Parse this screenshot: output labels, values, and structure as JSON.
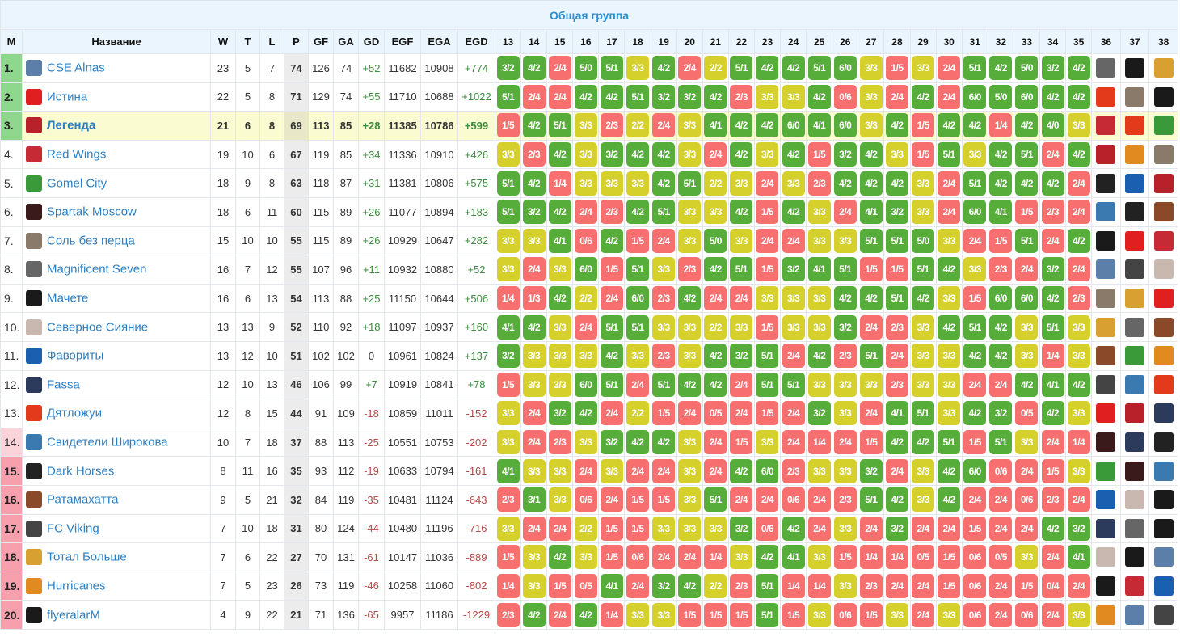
{
  "title": "Общая группа",
  "headers": {
    "m": "M",
    "name": "Название",
    "w": "W",
    "t": "T",
    "l": "L",
    "p": "P",
    "gf": "GF",
    "ga": "GA",
    "gd": "GD",
    "egf": "EGF",
    "ega": "EGA",
    "egd": "EGD"
  },
  "round_headers": [
    "13",
    "14",
    "15",
    "16",
    "17",
    "18",
    "19",
    "20",
    "21",
    "22",
    "23",
    "24",
    "25",
    "26",
    "27",
    "28",
    "29",
    "30",
    "31",
    "32",
    "33",
    "34",
    "35",
    "36",
    "37",
    "38"
  ],
  "colors": {
    "win": "#56ad3a",
    "draw": "#d6d02c",
    "loss": "#f76f6f",
    "accent": "#2a8fcf"
  },
  "logos": {
    "cse-alnas": "#5b7fa8",
    "istina": "#e02020",
    "legenda": "#b8202a",
    "red-wings": "#c52a35",
    "gomel-city": "#3a9a3a",
    "spartak-moscow": "#3a1a1a",
    "sol-bez-perca": "#8a7a6a",
    "magnificent-seven": "#666666",
    "machete": "#1a1a1a",
    "severnoe-siyanie": "#c8b8b0",
    "favority": "#1a5fb0",
    "fassa": "#2c3a5c",
    "dyatlozhui": "#e23a1a",
    "svideteli": "#3a7ab0",
    "dark-horses": "#222222",
    "ratamahatta": "#8a4a2a",
    "fc-viking": "#444444",
    "total-bolshe": "#d8a030",
    "hurricanes": "#e08a20",
    "flyeralarm": "#1a1a1a"
  },
  "rows": [
    {
      "pos": "1.",
      "zone": "top",
      "name": "CSE Alnas",
      "logo": "cse-alnas",
      "w": "23",
      "t": "5",
      "l": "7",
      "p": "74",
      "gf": "126",
      "ga": "74",
      "gd": "+52",
      "egf": "11682",
      "ega": "10908",
      "egd": "+774",
      "results": [
        "3/2",
        "4/2",
        "2/4",
        "5/0",
        "5/1",
        "3/3",
        "4/2",
        "2/4",
        "2/2",
        "5/1",
        "4/2",
        "4/2",
        "5/1",
        "6/0",
        "3/3",
        "1/5",
        "3/3",
        "2/4",
        "5/1",
        "4/2",
        "5/0",
        "3/2",
        "4/2"
      ],
      "next": [
        "magnificent-seven",
        "flyeralarm",
        "total-bolshe"
      ]
    },
    {
      "pos": "2.",
      "zone": "top",
      "name": "Истина",
      "logo": "istina",
      "w": "22",
      "t": "5",
      "l": "8",
      "p": "71",
      "gf": "129",
      "ga": "74",
      "gd": "+55",
      "egf": "11710",
      "ega": "10688",
      "egd": "+1022",
      "results": [
        "5/1",
        "2/4",
        "2/4",
        "4/2",
        "4/2",
        "5/1",
        "3/2",
        "3/2",
        "4/2",
        "2/3",
        "3/3",
        "3/3",
        "4/2",
        "0/6",
        "3/3",
        "2/4",
        "4/2",
        "2/4",
        "6/0",
        "5/0",
        "6/0",
        "4/2",
        "4/2"
      ],
      "next": [
        "dyatlozhui",
        "sol-bez-perca",
        "machete"
      ]
    },
    {
      "pos": "3.",
      "zone": "top",
      "highlight": true,
      "name": "Легенда",
      "logo": "legenda",
      "w": "21",
      "t": "6",
      "l": "8",
      "p": "69",
      "gf": "113",
      "ga": "85",
      "gd": "+28",
      "egf": "11385",
      "ega": "10786",
      "egd": "+599",
      "results": [
        "1/5",
        "4/2",
        "5/1",
        "3/3",
        "2/3",
        "2/2",
        "2/4",
        "3/3",
        "4/1",
        "4/2",
        "4/2",
        "6/0",
        "4/1",
        "6/0",
        "3/3",
        "4/2",
        "1/5",
        "4/2",
        "4/2",
        "1/4",
        "4/2",
        "4/0",
        "3/3"
      ],
      "next": [
        "red-wings",
        "dyatlozhui",
        "gomel-city"
      ]
    },
    {
      "pos": "4.",
      "zone": "mid",
      "name": "Red Wings",
      "logo": "red-wings",
      "w": "19",
      "t": "10",
      "l": "6",
      "p": "67",
      "gf": "119",
      "ga": "85",
      "gd": "+34",
      "egf": "11336",
      "ega": "10910",
      "egd": "+426",
      "results": [
        "3/3",
        "2/3",
        "4/2",
        "3/3",
        "3/2",
        "4/2",
        "4/2",
        "3/3",
        "2/4",
        "4/2",
        "3/3",
        "4/2",
        "1/5",
        "3/2",
        "4/2",
        "3/3",
        "1/5",
        "5/1",
        "3/3",
        "4/2",
        "5/1",
        "2/4",
        "4/2"
      ],
      "next": [
        "legenda",
        "hurricanes",
        "sol-bez-perca"
      ]
    },
    {
      "pos": "5.",
      "zone": "mid",
      "name": "Gomel City",
      "logo": "gomel-city",
      "w": "18",
      "t": "9",
      "l": "8",
      "p": "63",
      "gf": "118",
      "ga": "87",
      "gd": "+31",
      "egf": "11381",
      "ega": "10806",
      "egd": "+575",
      "results": [
        "5/1",
        "4/2",
        "1/4",
        "3/3",
        "3/3",
        "3/3",
        "4/2",
        "5/1",
        "2/2",
        "3/3",
        "2/4",
        "3/3",
        "2/3",
        "4/2",
        "4/2",
        "4/2",
        "3/3",
        "2/4",
        "5/1",
        "4/2",
        "4/2",
        "4/2",
        "2/4"
      ],
      "next": [
        "dark-horses",
        "favority",
        "legenda"
      ]
    },
    {
      "pos": "6.",
      "zone": "mid",
      "name": "Spartak Moscow",
      "logo": "spartak-moscow",
      "w": "18",
      "t": "6",
      "l": "11",
      "p": "60",
      "gf": "115",
      "ga": "89",
      "gd": "+26",
      "egf": "11077",
      "ega": "10894",
      "egd": "+183",
      "results": [
        "5/1",
        "3/2",
        "4/2",
        "2/4",
        "2/3",
        "4/2",
        "5/1",
        "3/3",
        "3/3",
        "4/2",
        "1/5",
        "4/2",
        "3/3",
        "2/4",
        "4/1",
        "3/2",
        "3/3",
        "2/4",
        "6/0",
        "4/1",
        "1/5",
        "2/3",
        "2/4"
      ],
      "next": [
        "svideteli",
        "dark-horses",
        "ratamahatta"
      ]
    },
    {
      "pos": "7.",
      "zone": "mid",
      "name": "Соль без перца",
      "logo": "sol-bez-perca",
      "w": "15",
      "t": "10",
      "l": "10",
      "p": "55",
      "gf": "115",
      "ga": "89",
      "gd": "+26",
      "egf": "10929",
      "ega": "10647",
      "egd": "+282",
      "results": [
        "3/3",
        "3/3",
        "4/1",
        "0/6",
        "4/2",
        "1/5",
        "2/4",
        "3/3",
        "5/0",
        "3/3",
        "2/4",
        "2/4",
        "3/3",
        "3/3",
        "5/1",
        "5/1",
        "5/0",
        "3/3",
        "2/4",
        "1/5",
        "5/1",
        "2/4",
        "4/2"
      ],
      "next": [
        "machete",
        "istina",
        "red-wings"
      ]
    },
    {
      "pos": "8.",
      "zone": "mid",
      "name": "Magnificent Seven",
      "logo": "magnificent-seven",
      "w": "16",
      "t": "7",
      "l": "12",
      "p": "55",
      "gf": "107",
      "ga": "96",
      "gd": "+11",
      "egf": "10932",
      "ega": "10880",
      "egd": "+52",
      "results": [
        "3/3",
        "2/4",
        "3/3",
        "6/0",
        "1/5",
        "5/1",
        "3/3",
        "2/3",
        "4/2",
        "5/1",
        "1/5",
        "3/2",
        "4/1",
        "5/1",
        "1/5",
        "1/5",
        "5/1",
        "4/2",
        "3/3",
        "2/3",
        "2/4",
        "3/2",
        "2/4"
      ],
      "next": [
        "cse-alnas",
        "fc-viking",
        "severnoe-siyanie"
      ]
    },
    {
      "pos": "9.",
      "zone": "mid",
      "name": "Мачете",
      "logo": "machete",
      "w": "16",
      "t": "6",
      "l": "13",
      "p": "54",
      "gf": "113",
      "ga": "88",
      "gd": "+25",
      "egf": "11150",
      "ega": "10644",
      "egd": "+506",
      "results": [
        "1/4",
        "1/3",
        "4/2",
        "2/2",
        "2/4",
        "6/0",
        "2/3",
        "4/2",
        "2/4",
        "2/4",
        "3/3",
        "3/3",
        "3/3",
        "4/2",
        "4/2",
        "5/1",
        "4/2",
        "3/3",
        "1/5",
        "6/0",
        "6/0",
        "4/2",
        "2/3"
      ],
      "next": [
        "sol-bez-perca",
        "total-bolshe",
        "istina"
      ]
    },
    {
      "pos": "10.",
      "zone": "mid",
      "name": "Северное Сияние",
      "logo": "severnoe-siyanie",
      "w": "13",
      "t": "13",
      "l": "9",
      "p": "52",
      "gf": "110",
      "ga": "92",
      "gd": "+18",
      "egf": "11097",
      "ega": "10937",
      "egd": "+160",
      "results": [
        "4/1",
        "4/2",
        "3/3",
        "2/4",
        "5/1",
        "5/1",
        "3/3",
        "3/3",
        "2/2",
        "3/3",
        "1/5",
        "3/3",
        "3/3",
        "3/2",
        "2/4",
        "2/3",
        "3/3",
        "4/2",
        "5/1",
        "4/2",
        "3/3",
        "5/1",
        "3/3"
      ],
      "next": [
        "total-bolshe",
        "magnificent-seven",
        "ratamahatta"
      ]
    },
    {
      "pos": "11.",
      "zone": "mid",
      "name": "Фавориты",
      "logo": "favority",
      "w": "13",
      "t": "12",
      "l": "10",
      "p": "51",
      "gf": "102",
      "ga": "102",
      "gd": "0",
      "egf": "10961",
      "ega": "10824",
      "egd": "+137",
      "results": [
        "3/2",
        "3/3",
        "3/3",
        "3/3",
        "4/2",
        "3/3",
        "2/3",
        "3/3",
        "4/2",
        "3/2",
        "5/1",
        "2/4",
        "4/2",
        "2/3",
        "5/1",
        "2/4",
        "3/3",
        "3/3",
        "4/2",
        "4/2",
        "3/3",
        "1/4",
        "3/3"
      ],
      "next": [
        "ratamahatta",
        "gomel-city",
        "hurricanes"
      ]
    },
    {
      "pos": "12.",
      "zone": "mid",
      "name": "Fassa",
      "logo": "fassa",
      "w": "12",
      "t": "10",
      "l": "13",
      "p": "46",
      "gf": "106",
      "ga": "99",
      "gd": "+7",
      "egf": "10919",
      "ega": "10841",
      "egd": "+78",
      "results": [
        "1/5",
        "3/3",
        "3/3",
        "6/0",
        "5/1",
        "2/4",
        "5/1",
        "4/2",
        "4/2",
        "2/4",
        "5/1",
        "5/1",
        "3/3",
        "3/3",
        "3/3",
        "2/3",
        "3/3",
        "3/3",
        "2/4",
        "2/4",
        "4/2",
        "4/1",
        "4/2"
      ],
      "next": [
        "fc-viking",
        "svideteli",
        "dyatlozhui"
      ]
    },
    {
      "pos": "13.",
      "zone": "mid",
      "name": "Дятложуи",
      "logo": "dyatlozhui",
      "w": "12",
      "t": "8",
      "l": "15",
      "p": "44",
      "gf": "91",
      "ga": "109",
      "gd": "-18",
      "egf": "10859",
      "ega": "11011",
      "egd": "-152",
      "results": [
        "3/3",
        "2/4",
        "3/2",
        "4/2",
        "2/4",
        "2/2",
        "1/5",
        "2/4",
        "0/5",
        "2/4",
        "1/5",
        "2/4",
        "3/2",
        "3/3",
        "2/4",
        "4/1",
        "5/1",
        "3/3",
        "4/2",
        "3/2",
        "0/5",
        "4/2",
        "3/3"
      ],
      "next": [
        "istina",
        "legenda",
        "fassa"
      ]
    },
    {
      "pos": "14.",
      "zone": "warn",
      "name": "Свидетели Широкова",
      "logo": "svideteli",
      "w": "10",
      "t": "7",
      "l": "18",
      "p": "37",
      "gf": "88",
      "ga": "113",
      "gd": "-25",
      "egf": "10551",
      "ega": "10753",
      "egd": "-202",
      "results": [
        "3/3",
        "2/4",
        "2/3",
        "3/3",
        "3/2",
        "4/2",
        "4/2",
        "3/3",
        "2/4",
        "1/5",
        "3/3",
        "2/4",
        "1/4",
        "2/4",
        "1/5",
        "4/2",
        "4/2",
        "5/1",
        "1/5",
        "5/1",
        "3/3",
        "2/4",
        "1/4"
      ],
      "next": [
        "spartak-moscow",
        "fassa",
        "dark-horses"
      ]
    },
    {
      "pos": "15.",
      "zone": "rel",
      "name": "Dark Horses",
      "logo": "dark-horses",
      "w": "8",
      "t": "11",
      "l": "16",
      "p": "35",
      "gf": "93",
      "ga": "112",
      "gd": "-19",
      "egf": "10633",
      "ega": "10794",
      "egd": "-161",
      "results": [
        "4/1",
        "3/3",
        "3/3",
        "2/4",
        "3/3",
        "2/4",
        "2/4",
        "3/3",
        "2/4",
        "4/2",
        "6/0",
        "2/3",
        "3/3",
        "3/3",
        "3/2",
        "2/4",
        "3/3",
        "4/2",
        "6/0",
        "0/6",
        "2/4",
        "1/5",
        "3/3"
      ],
      "next": [
        "gomel-city",
        "spartak-moscow",
        "svideteli"
      ]
    },
    {
      "pos": "16.",
      "zone": "rel",
      "name": "Ратамахатта",
      "logo": "ratamahatta",
      "w": "9",
      "t": "5",
      "l": "21",
      "p": "32",
      "gf": "84",
      "ga": "119",
      "gd": "-35",
      "egf": "10481",
      "ega": "11124",
      "egd": "-643",
      "results": [
        "2/3",
        "3/1",
        "3/3",
        "0/6",
        "2/4",
        "1/5",
        "1/5",
        "3/3",
        "5/1",
        "2/4",
        "2/4",
        "0/6",
        "2/4",
        "2/3",
        "5/1",
        "4/2",
        "3/3",
        "4/2",
        "2/4",
        "2/4",
        "0/6",
        "2/3",
        "2/4"
      ],
      "next": [
        "favority",
        "severnoe-siyanie",
        "machete"
      ]
    },
    {
      "pos": "17.",
      "zone": "rel",
      "name": "FC Viking",
      "logo": "fc-viking",
      "w": "7",
      "t": "10",
      "l": "18",
      "p": "31",
      "gf": "80",
      "ga": "124",
      "gd": "-44",
      "egf": "10480",
      "ega": "11196",
      "egd": "-716",
      "results": [
        "3/3",
        "2/4",
        "2/4",
        "2/2",
        "1/5",
        "1/5",
        "3/3",
        "3/3",
        "3/3",
        "3/2",
        "0/6",
        "4/2",
        "2/4",
        "3/3",
        "2/4",
        "3/2",
        "2/4",
        "2/4",
        "1/5",
        "2/4",
        "2/4",
        "4/2",
        "3/2"
      ],
      "next": [
        "fassa",
        "magnificent-seven",
        "flyeralarm"
      ]
    },
    {
      "pos": "18.",
      "zone": "rel",
      "name": "Тотал Больше",
      "logo": "total-bolshe",
      "w": "7",
      "t": "6",
      "l": "22",
      "p": "27",
      "gf": "70",
      "ga": "131",
      "gd": "-61",
      "egf": "10147",
      "ega": "11036",
      "egd": "-889",
      "results": [
        "1/5",
        "3/3",
        "4/2",
        "3/3",
        "1/5",
        "0/6",
        "2/4",
        "2/4",
        "1/4",
        "3/3",
        "4/2",
        "4/1",
        "3/3",
        "1/5",
        "1/4",
        "1/4",
        "0/5",
        "1/5",
        "0/6",
        "0/5",
        "3/3",
        "2/4",
        "4/1"
      ],
      "next": [
        "severnoe-siyanie",
        "machete",
        "cse-alnas"
      ]
    },
    {
      "pos": "19.",
      "zone": "rel",
      "name": "Hurricanes",
      "logo": "hurricanes",
      "w": "7",
      "t": "5",
      "l": "23",
      "p": "26",
      "gf": "73",
      "ga": "119",
      "gd": "-46",
      "egf": "10258",
      "ega": "11060",
      "egd": "-802",
      "results": [
        "1/4",
        "3/3",
        "1/5",
        "0/5",
        "4/1",
        "2/4",
        "3/2",
        "4/2",
        "2/2",
        "2/3",
        "5/1",
        "1/4",
        "1/4",
        "3/3",
        "2/3",
        "2/4",
        "2/4",
        "1/5",
        "0/6",
        "2/4",
        "1/5",
        "0/4",
        "2/4"
      ],
      "next": [
        "flyeralarm",
        "red-wings",
        "favority"
      ]
    },
    {
      "pos": "20.",
      "zone": "rel",
      "name": "flyeralarM",
      "logo": "flyeralarm",
      "w": "4",
      "t": "9",
      "l": "22",
      "p": "21",
      "gf": "71",
      "ga": "136",
      "gd": "-65",
      "egf": "9957",
      "ega": "11186",
      "egd": "-1229",
      "results": [
        "2/3",
        "4/2",
        "2/4",
        "4/2",
        "1/4",
        "3/3",
        "3/3",
        "1/5",
        "1/5",
        "1/5",
        "5/1",
        "1/5",
        "3/3",
        "0/6",
        "1/5",
        "3/3",
        "2/4",
        "3/3",
        "0/6",
        "2/4",
        "0/6",
        "2/4",
        "3/3"
      ],
      "next": [
        "hurricanes",
        "cse-alnas",
        "fc-viking"
      ]
    }
  ]
}
